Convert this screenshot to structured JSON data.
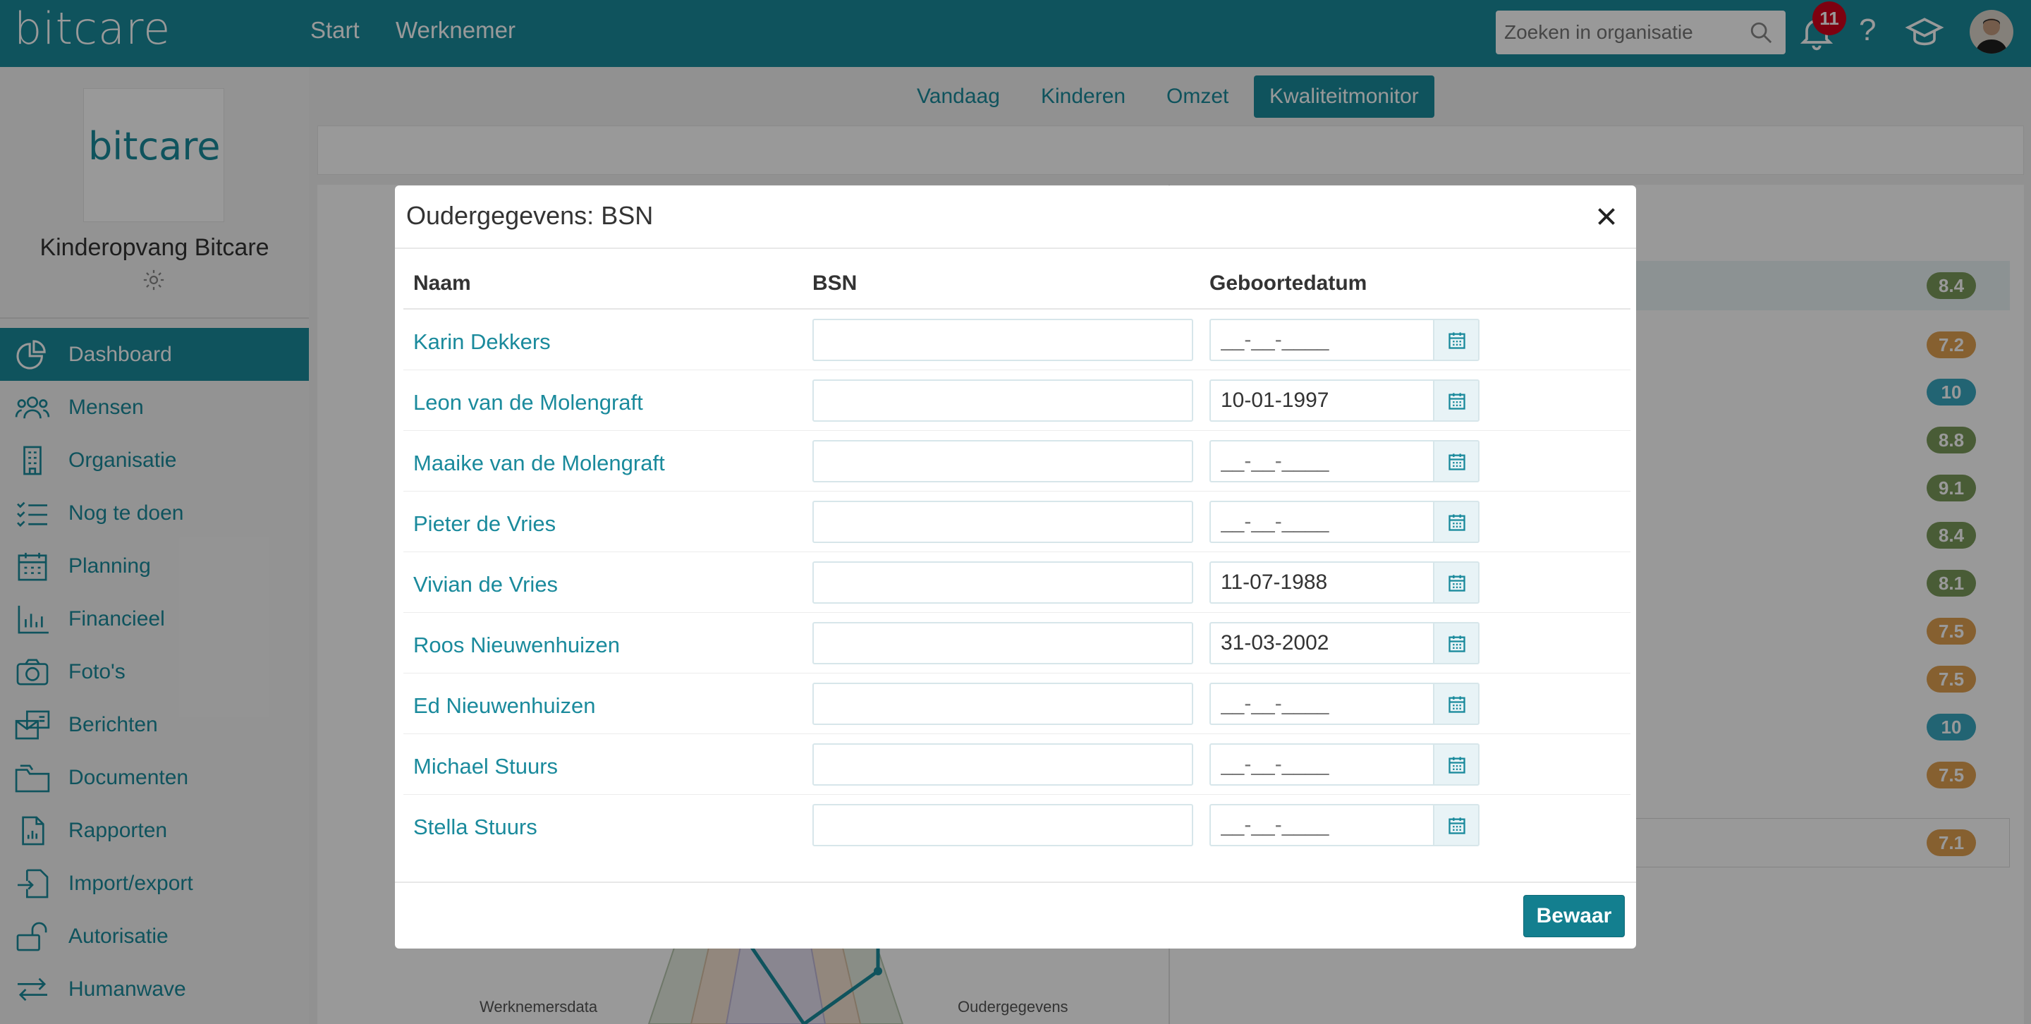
{
  "app": {
    "logo": "bitcare"
  },
  "topnav": {
    "start": "Start",
    "werknemer": "Werknemer"
  },
  "search": {
    "placeholder": "Zoeken in organisatie"
  },
  "notifications": {
    "count": "11"
  },
  "help": {
    "label": "?"
  },
  "sidebar": {
    "logo": "bitcare",
    "org_name": "Kinderopvang Bitcare",
    "items": [
      {
        "label": "Dashboard",
        "icon": "dashboard-icon"
      },
      {
        "label": "Mensen",
        "icon": "people-icon"
      },
      {
        "label": "Organisatie",
        "icon": "building-icon"
      },
      {
        "label": "Nog te doen",
        "icon": "checklist-icon"
      },
      {
        "label": "Planning",
        "icon": "calendar-icon"
      },
      {
        "label": "Financieel",
        "icon": "bar-chart-icon"
      },
      {
        "label": "Foto's",
        "icon": "camera-icon"
      },
      {
        "label": "Berichten",
        "icon": "messages-icon"
      },
      {
        "label": "Documenten",
        "icon": "folder-icon"
      },
      {
        "label": "Rapporten",
        "icon": "report-icon"
      },
      {
        "label": "Import/export",
        "icon": "import-export-icon"
      },
      {
        "label": "Autorisatie",
        "icon": "unlock-icon"
      },
      {
        "label": "Humanwave",
        "icon": "swap-arrows-icon"
      }
    ]
  },
  "subnav": {
    "tabs": [
      "Vandaag",
      "Kinderen",
      "Omzet",
      "Kwaliteitmonitor"
    ],
    "active": "Kwaliteitmonitor"
  },
  "background": {
    "scores": [
      "8.4",
      "7.2",
      "10",
      "8.8",
      "9.1",
      "8.4",
      "8.1",
      "7.5",
      "7.5",
      "10",
      "7.5"
    ],
    "total_score": "7.1",
    "radar_labels": [
      "Werknemersdata",
      "Oudergegevens"
    ]
  },
  "colors": {
    "brand": "#1a8a9c",
    "green": "#7a9a5a",
    "orange": "#e0a050",
    "blue": "#3aa7c0",
    "badge_red": "#d0021b"
  },
  "modal": {
    "title": "Oudergegevens: BSN",
    "columns": {
      "name": "Naam",
      "bsn": "BSN",
      "dob": "Geboortedatum"
    },
    "date_placeholder": "__-__-____",
    "rows": [
      {
        "name": "Karin Dekkers",
        "bsn": "",
        "dob": ""
      },
      {
        "name": "Leon van de Molengraft",
        "bsn": "",
        "dob": "10-01-1997"
      },
      {
        "name": "Maaike van de Molengraft",
        "bsn": "",
        "dob": ""
      },
      {
        "name": "Pieter de Vries",
        "bsn": "",
        "dob": ""
      },
      {
        "name": "Vivian de Vries",
        "bsn": "",
        "dob": "11-07-1988"
      },
      {
        "name": "Roos Nieuwenhuizen",
        "bsn": "",
        "dob": "31-03-2002"
      },
      {
        "name": "Ed Nieuwenhuizen",
        "bsn": "",
        "dob": ""
      },
      {
        "name": "Michael Stuurs",
        "bsn": "",
        "dob": ""
      },
      {
        "name": "Stella Stuurs",
        "bsn": "",
        "dob": ""
      }
    ],
    "save_label": "Bewaar"
  }
}
